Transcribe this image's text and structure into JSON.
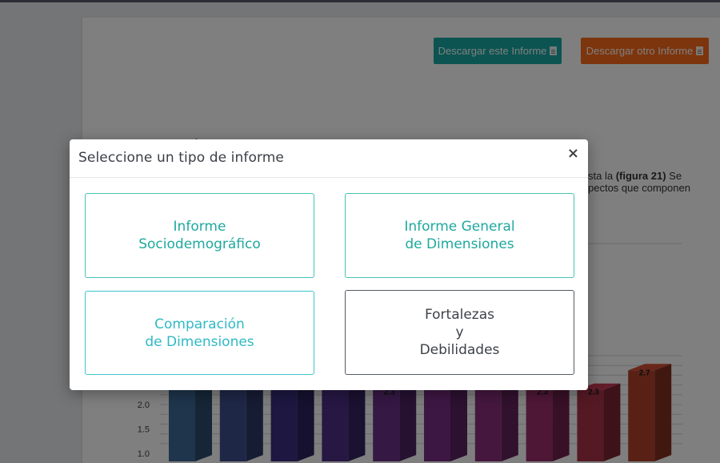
{
  "header": {
    "download_this": "Descargar este Informe",
    "download_other": "Descargar otro Informe"
  },
  "background": {
    "heading_fragment": "'",
    "paragraph_line1_a": "sta la ",
    "paragraph_line1_b": "(figura 21)",
    "paragraph_line1_c": " Se",
    "paragraph_line2": "pectos que componen"
  },
  "modal": {
    "title": "Seleccione un tipo de informe",
    "close_label": "×",
    "options": [
      {
        "label": "Informe\nSociodemográfico"
      },
      {
        "label": "Informe General\nde Dimensiones"
      },
      {
        "label": "Comparación\nde Dimensiones"
      },
      {
        "label": "Fortalezas\ny\nDebilidades"
      }
    ]
  },
  "colors": {
    "teal": "#17a9a3",
    "orange": "#fb6a1a",
    "option_teal": "#1ea99e",
    "option_cyan": "#2fb9c5"
  },
  "chart_data": {
    "type": "bar",
    "title": "",
    "xlabel": "",
    "ylabel": "",
    "ylim": [
      1.0,
      3.0
    ],
    "yticks": [
      "1.0",
      "1.5",
      "2.0"
    ],
    "values": [
      2.4,
      2.4,
      2.4,
      2.3,
      2.3,
      2.4,
      2.4,
      2.3,
      2.3,
      2.7
    ],
    "data_labels": [
      "",
      "",
      "2.4",
      "",
      "2.3",
      "",
      "",
      "2.3",
      "2.3",
      "2.7"
    ],
    "colors": [
      "#3d6b97",
      "#3f4f8f",
      "#3a2f83",
      "#4c2f86",
      "#6a3088",
      "#7a2f86",
      "#8a2f7e",
      "#9c2e6c",
      "#a93247",
      "#b3432d"
    ]
  }
}
